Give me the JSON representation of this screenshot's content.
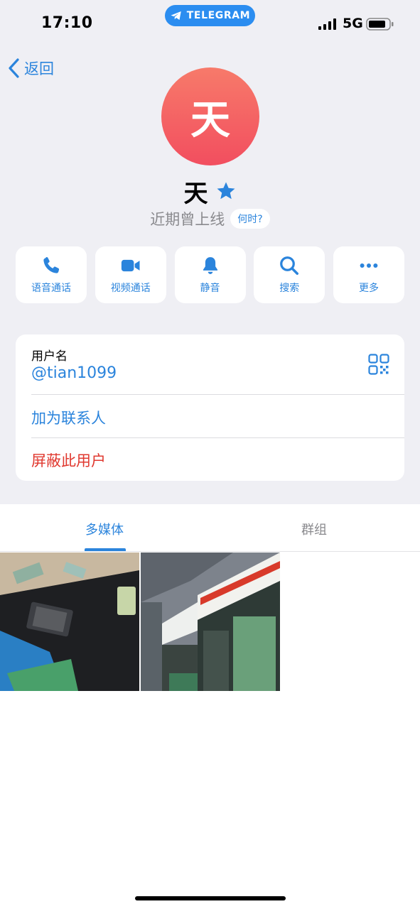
{
  "status_bar": {
    "time": "17:10",
    "app_pill": "TELEGRAM",
    "network": "5G"
  },
  "nav": {
    "back_label": "返回"
  },
  "profile": {
    "avatar_letter": "天",
    "name": "天",
    "last_seen": "近期曾上线",
    "when_label": "何时?"
  },
  "actions": [
    {
      "icon": "phone-icon",
      "label": "语音通话"
    },
    {
      "icon": "video-icon",
      "label": "视频通话"
    },
    {
      "icon": "bell-icon",
      "label": "静音"
    },
    {
      "icon": "search-icon",
      "label": "搜索"
    },
    {
      "icon": "more-icon",
      "label": "更多"
    }
  ],
  "info": {
    "username_label": "用户名",
    "username_value": "@tian1099",
    "add_contact": "加为联系人",
    "block_user": "屏蔽此用户"
  },
  "tabs": {
    "media": "多媒体",
    "groups": "群组"
  },
  "colors": {
    "accent": "#2b84dc",
    "danger": "#e0382f",
    "avatar_top": "#f77a6a",
    "avatar_bottom": "#f24e5f",
    "background": "#efeff4"
  }
}
